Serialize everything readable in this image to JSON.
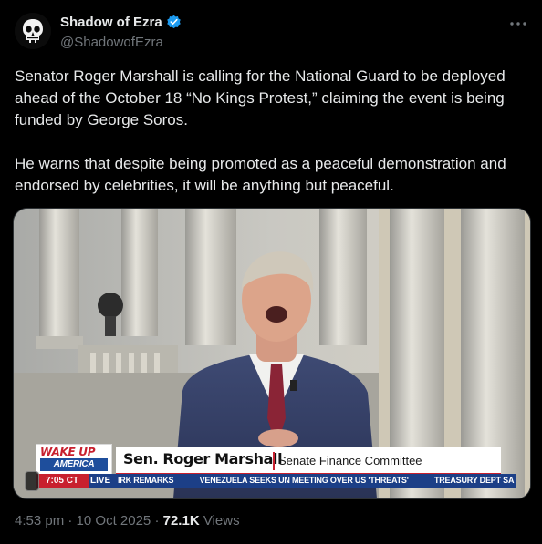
{
  "author": {
    "display_name": "Shadow of Ezra",
    "handle": "@ShadowofEzra",
    "verified": true,
    "avatar_icon": "punisher-skull-icon"
  },
  "more_icon": "more-horizontal-icon",
  "tweet_text": "Senator Roger Marshall is calling for the National Guard to be deployed ahead of the October 18 “No Kings Protest,” claiming the event is being funded by George Soros.\n\nHe warns that despite being promoted as a peaceful demonstration and endorsed by celebrities, it will be anything but peaceful.",
  "video": {
    "show_logo_line1": "WAKE UP",
    "show_logo_line2": "AMERICA",
    "speaker_name": "Sen. Roger Marshall",
    "speaker_title": "Senate Finance Committee",
    "ticker_time": "7:05 CT",
    "ticker_live": "LIVE",
    "ticker_items": [
      "IRK REMARKS",
      "VENEZUELA SEEKS UN MEETING OVER US 'THREATS'",
      "TREASURY DEPT SA"
    ]
  },
  "footer": {
    "time": "4:53 pm",
    "separator": "·",
    "date": "10 Oct 2025",
    "views_count": "72.1K",
    "views_label": "Views"
  },
  "colors": {
    "background": "#000000",
    "text_primary": "#e7e9ea",
    "text_secondary": "#71767b",
    "verified_blue": "#1d9bf0",
    "chyron_red": "#c8202e",
    "chyron_blue": "#1c3f87"
  }
}
